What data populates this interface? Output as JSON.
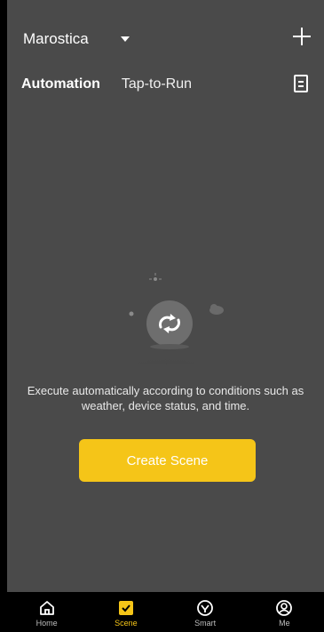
{
  "header": {
    "home_name": "Marostica",
    "add_icon": "plus-icon",
    "log_icon": "log-document-icon"
  },
  "tabs": [
    {
      "label": "Automation",
      "active": true
    },
    {
      "label": "Tap-to-Run",
      "active": false
    }
  ],
  "empty_state": {
    "illustration_icon": "automation-cycle-icon",
    "message": "Execute automatically according to conditions such as weather, device status, and time.",
    "button_label": "Create Scene"
  },
  "bottom_nav": {
    "items": [
      {
        "label": "Home",
        "icon": "home-icon",
        "active": false
      },
      {
        "label": "Scene",
        "icon": "scene-check-icon",
        "active": true
      },
      {
        "label": "Smart",
        "icon": "smart-icon",
        "active": false
      },
      {
        "label": "Me",
        "icon": "profile-icon",
        "active": false
      }
    ]
  },
  "colors": {
    "background": "#4a4a4a",
    "accent": "#f5c518",
    "nav_background": "#000000"
  }
}
